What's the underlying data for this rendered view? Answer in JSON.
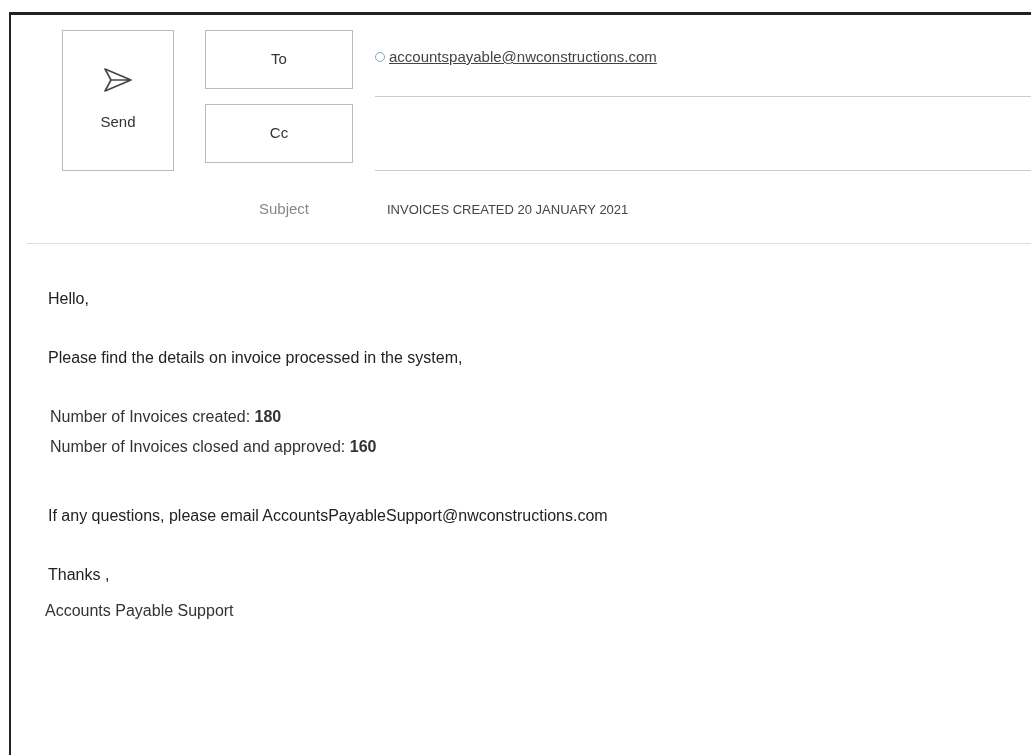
{
  "send_button": {
    "label": "Send"
  },
  "recipients": [
    {
      "label": "To",
      "value": "accountspayable@nwconstructions.com"
    },
    {
      "label": "Cc"
    }
  ],
  "subject": {
    "label": "Subject",
    "value": "INVOICES CREATED 20 JANUARY 2021"
  },
  "body": [
    {
      "kind": "paragraph",
      "text": "Hello,"
    },
    {
      "kind": "paragraph",
      "text": "Please find the details on invoice processed in the system,"
    },
    {
      "kind": "list",
      "lines": [
        "Number of Invoices created: **180**",
        "Number of Invoices closed and approved: **160**"
      ]
    },
    {
      "kind": "paragraph",
      "text": "If any questions, please email AccountsPayableSupport@nwconstructions.com"
    },
    {
      "kind": "signature",
      "lines": [
        "Thanks ,",
        "Accounts Payable Support"
      ]
    }
  ]
}
